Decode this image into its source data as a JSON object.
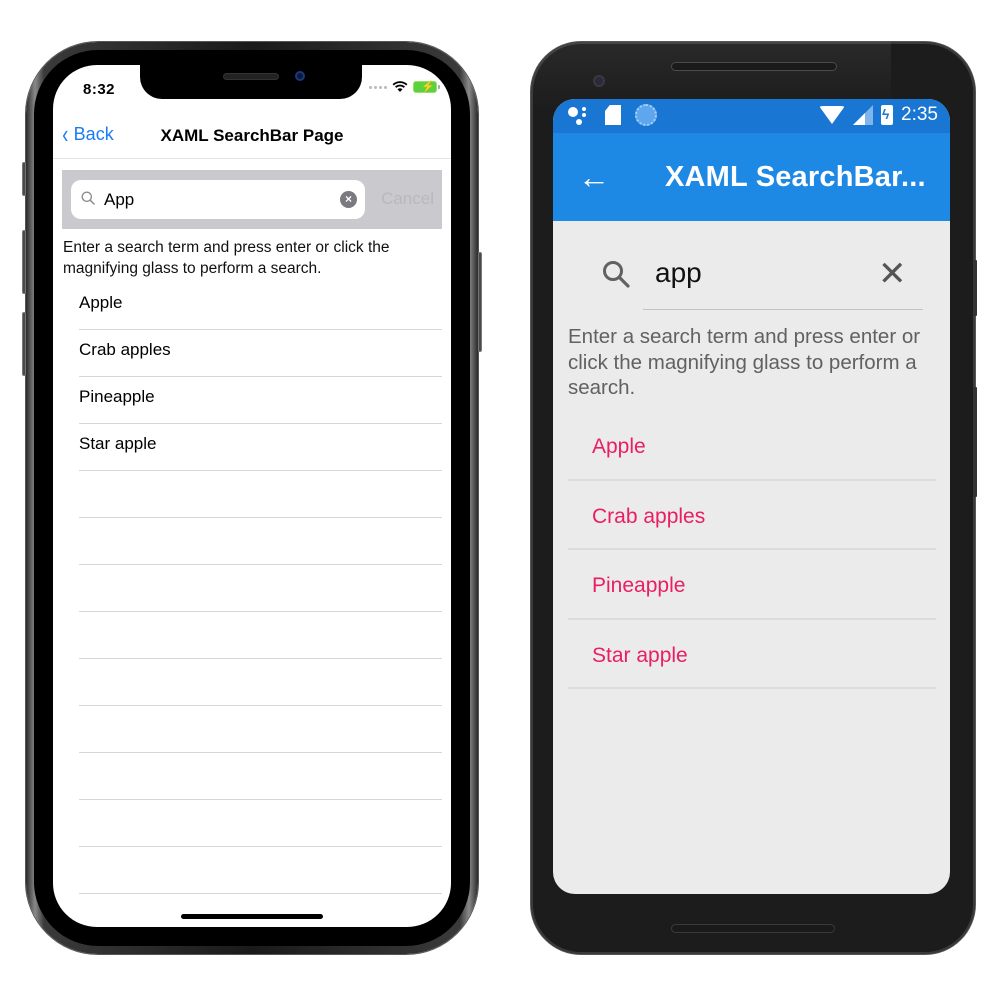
{
  "ios": {
    "status_bar": {
      "time": "8:32",
      "icons": [
        "signal-dots-icon",
        "wifi-icon",
        "battery-charging-icon"
      ],
      "battery_bolt": "⚡"
    },
    "navbar": {
      "back_glyph": "‹",
      "back_label": "Back",
      "title": "XAML SearchBar Page"
    },
    "searchbar": {
      "value": "App",
      "clear_glyph": "×",
      "cancel_label": "Cancel"
    },
    "hint": "Enter a search term and press enter or click the magnifying glass to perform a search.",
    "results": [
      "Apple",
      "Crab apples",
      "Pineapple",
      "Star apple"
    ],
    "empty_rows": 9
  },
  "android": {
    "status_bar": {
      "time": "2:35",
      "left_icons": [
        "assistant-dots-icon",
        "sd-card-icon",
        "sync-icon"
      ],
      "right_icons": [
        "wifi-icon",
        "cell-signal-icon",
        "battery-charging-icon"
      ],
      "battery_bolt": "ϟ"
    },
    "toolbar": {
      "back_glyph": "←",
      "title": "XAML SearchBar..."
    },
    "searchbar": {
      "value": "app",
      "clear_glyph": "✕"
    },
    "hint": "Enter a search term and press enter or click the magnifying glass to perform a search.",
    "results": [
      "Apple",
      "Crab apples",
      "Pineapple",
      "Star apple"
    ]
  },
  "colors": {
    "ios_accent": "#1a7cf2",
    "android_statusbar": "#1976d2",
    "android_toolbar": "#1e88e5",
    "android_result_text": "#e91e63"
  }
}
